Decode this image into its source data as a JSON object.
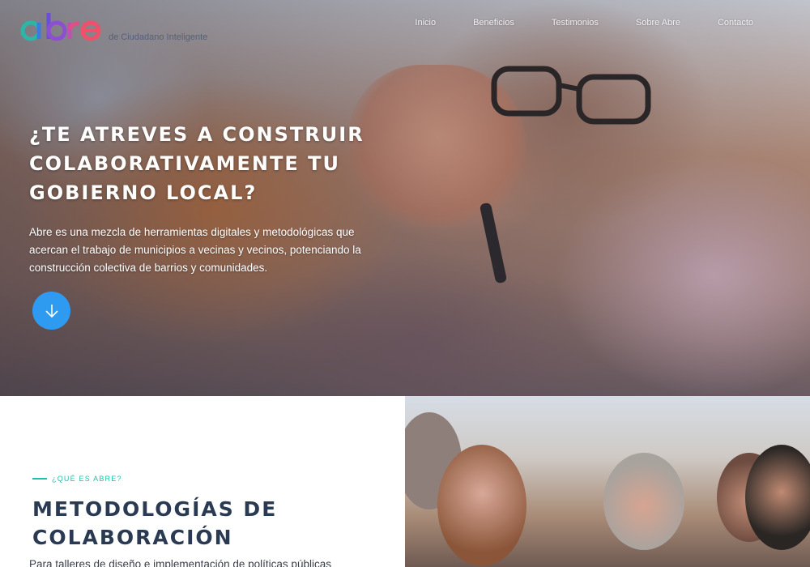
{
  "brand": {
    "logo_text": "abre",
    "tagline": "de Ciudadano Inteligente"
  },
  "nav": {
    "items": [
      {
        "label": "Inicio"
      },
      {
        "label": "Beneficios"
      },
      {
        "label": "Testimonios"
      },
      {
        "label": "Sobre Abre"
      },
      {
        "label": "Contacto"
      }
    ]
  },
  "hero": {
    "title": "¿TE ATREVES A CONSTRUIR COLABORATIVAMENTE TU GOBIERNO LOCAL?",
    "description": "Abre es una mezcla de herramientas digitales y metodológicas que acercan el trabajo de municipios a vecinas y vecinos, potenciando la construcción colectiva de barrios y comunidades.",
    "scroll_icon": "arrow-down-icon"
  },
  "about": {
    "eyebrow": "¿QUÉ ES ABRE?",
    "title": "METODOLOGÍAS DE COLABORACIÓN",
    "description": "Para talleres de diseño e implementación de políticas públicas"
  },
  "colors": {
    "accent": "#2f9bf0",
    "teal": "#19c2a8",
    "heading_dark": "#2a3a52"
  }
}
